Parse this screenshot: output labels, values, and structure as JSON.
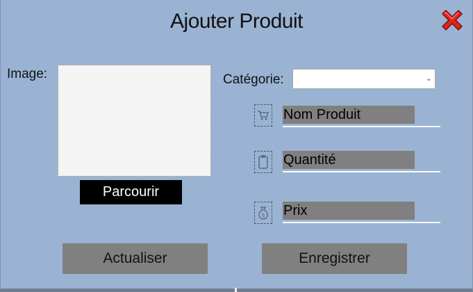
{
  "window": {
    "title": "Ajouter Produit"
  },
  "image_section": {
    "label": "Image:",
    "browse_label": "Parcourir"
  },
  "category": {
    "label": "Catégorie:",
    "selected": ""
  },
  "fields": {
    "name": {
      "value": "Nom Produit",
      "icon": "cart-icon"
    },
    "quantity": {
      "value": "Quantité",
      "icon": "clipboard-icon"
    },
    "price": {
      "value": "Prix",
      "icon": "money-bag-icon"
    }
  },
  "buttons": {
    "refresh_label": "Actualiser",
    "save_label": "Enregistrer"
  },
  "colors": {
    "background": "#9ab3d3",
    "field_bg": "#808080",
    "close_red": "#e0231e"
  }
}
